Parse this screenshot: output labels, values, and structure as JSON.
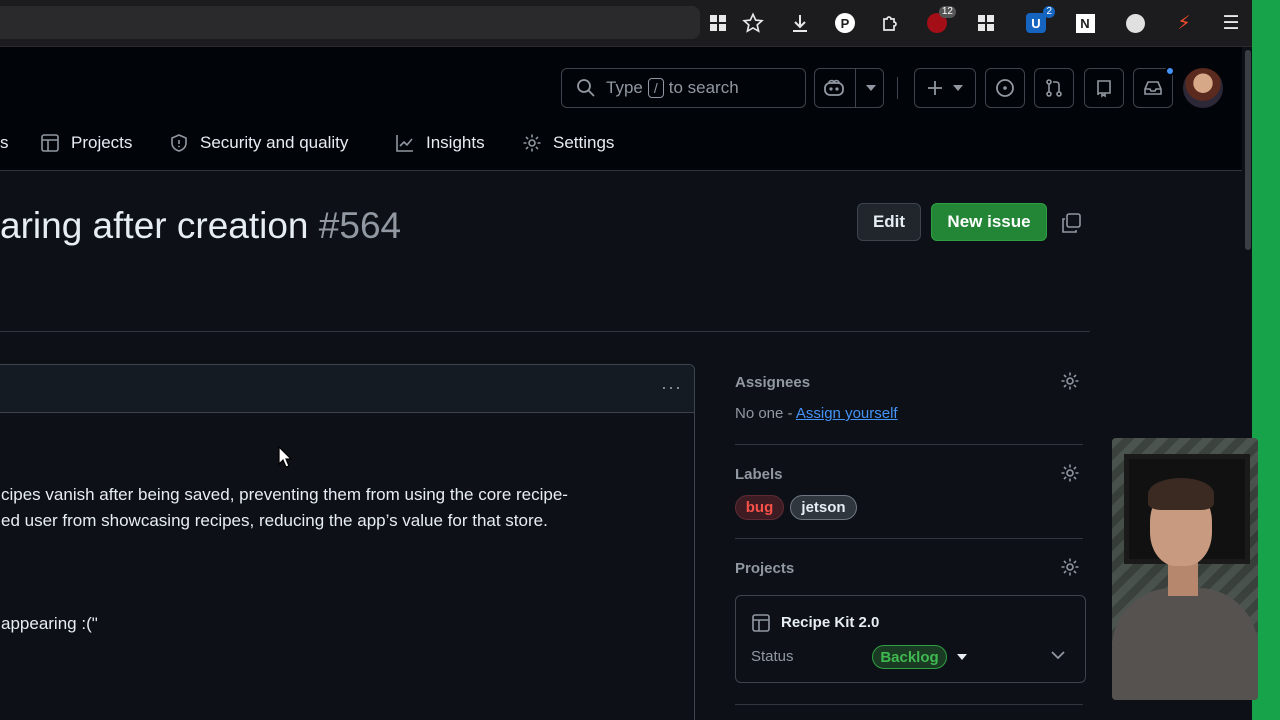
{
  "browser": {
    "extensions": [
      {
        "name": "apps-grid-icon"
      },
      {
        "name": "star-icon"
      },
      {
        "name": "download-icon"
      },
      {
        "name": "p-extension-icon",
        "text": "P"
      },
      {
        "name": "puzzle-icon"
      },
      {
        "name": "ublock-icon",
        "badge": "12"
      },
      {
        "name": "grid-extension-icon"
      },
      {
        "name": "u-extension-icon",
        "text": "U",
        "badge": "2"
      },
      {
        "name": "n-extension-icon",
        "text": "N"
      },
      {
        "name": "circle-extension-icon"
      },
      {
        "name": "bolt-extension-icon",
        "text": "⚡"
      },
      {
        "name": "menu-icon",
        "text": "☰"
      }
    ]
  },
  "header": {
    "search": {
      "prefix": "Type",
      "key": "/",
      "suffix": "to search"
    }
  },
  "nav": {
    "partial": "s",
    "projects": "Projects",
    "security": "Security and quality",
    "insights": "Insights",
    "settings": "Settings"
  },
  "issue": {
    "title": "aring after creation",
    "number": "#564",
    "edit_label": "Edit",
    "new_issue_label": "New issue"
  },
  "comment": {
    "menu": "···",
    "line1": "cipes vanish after being saved, preventing them from using the core recipe-",
    "line2": "ed user from showcasing recipes, reducing the app’s value for that store.",
    "line3": "appearing :(\""
  },
  "sidebar": {
    "assignees": {
      "heading": "Assignees",
      "none": "No one - ",
      "assign_link": "Assign yourself"
    },
    "labels": {
      "heading": "Labels",
      "items": [
        "bug",
        "jetson"
      ]
    },
    "projects": {
      "heading": "Projects",
      "project_name": "Recipe Kit 2.0",
      "status_label": "Status",
      "status_value": "Backlog"
    }
  },
  "colors": {
    "background": "#0d1117",
    "header": "#010409",
    "accent_green": "#238636",
    "link_blue": "#4493f8",
    "bug_red": "#f85149",
    "status_green": "#3fb950"
  }
}
